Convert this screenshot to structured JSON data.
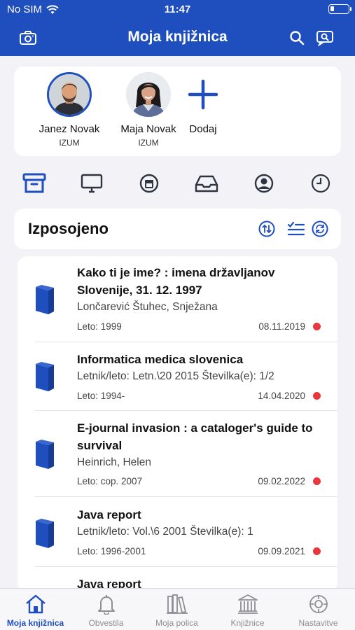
{
  "status": {
    "carrier": "No SIM",
    "time": "11:47",
    "icons": [
      "wifi-icon",
      "battery-icon"
    ]
  },
  "nav": {
    "title": "Moja knjižnica",
    "icons": [
      "camera-icon",
      "search-icon",
      "search-chat-icon"
    ]
  },
  "profiles": [
    {
      "name": "Janez Novak",
      "org": "IZUM",
      "active": true
    },
    {
      "name": "Maja Novak",
      "org": "IZUM",
      "active": false
    }
  ],
  "add_label": "Dodaj",
  "categories": [
    "archive-icon",
    "monitor-icon",
    "box-icon",
    "inbox-icon",
    "user-circle-icon",
    "clock-icon"
  ],
  "section": {
    "title": "Izposojeno",
    "actions": [
      "swap-sort-icon",
      "checklist-icon",
      "refresh-icon"
    ]
  },
  "items": [
    {
      "title": "Kako ti je ime? : imena državljanov Slovenije, 31. 12. 1997",
      "subtitle": "Lončarević Štuhec, Snježana",
      "year": "Leto: 1999",
      "date": "08.11.2019",
      "flag": true
    },
    {
      "title": "Informatica medica slovenica",
      "subtitle": "Letnik/leto: Letn.\\20 2015 Številka(e): 1/2",
      "year": "Leto: 1994-",
      "date": "14.04.2020",
      "flag": true
    },
    {
      "title": "E-journal invasion : a cataloger's guide to survival",
      "subtitle": "Heinrich, Helen",
      "year": "Leto: cop. 2007",
      "date": "09.02.2022",
      "flag": true
    },
    {
      "title": "Java report",
      "subtitle": "Letnik/leto: Vol.\\6 2001 Številka(e): 1",
      "year": "Leto: 1996-2001",
      "date": "09.09.2021",
      "flag": true
    },
    {
      "title": "Java report"
    }
  ],
  "tabs": [
    {
      "label": "Moja knjižnica",
      "icon": "home-icon",
      "active": true
    },
    {
      "label": "Obvestila",
      "icon": "bell-icon",
      "active": false
    },
    {
      "label": "Moja polica",
      "icon": "bookshelf-icon",
      "active": false
    },
    {
      "label": "Knjižnice",
      "icon": "library-building-icon",
      "active": false
    },
    {
      "label": "Nastavitve",
      "icon": "settings-icon",
      "active": false
    }
  ],
  "colors": {
    "brand": "#1f4fbf",
    "due_flag": "#e8383d"
  }
}
